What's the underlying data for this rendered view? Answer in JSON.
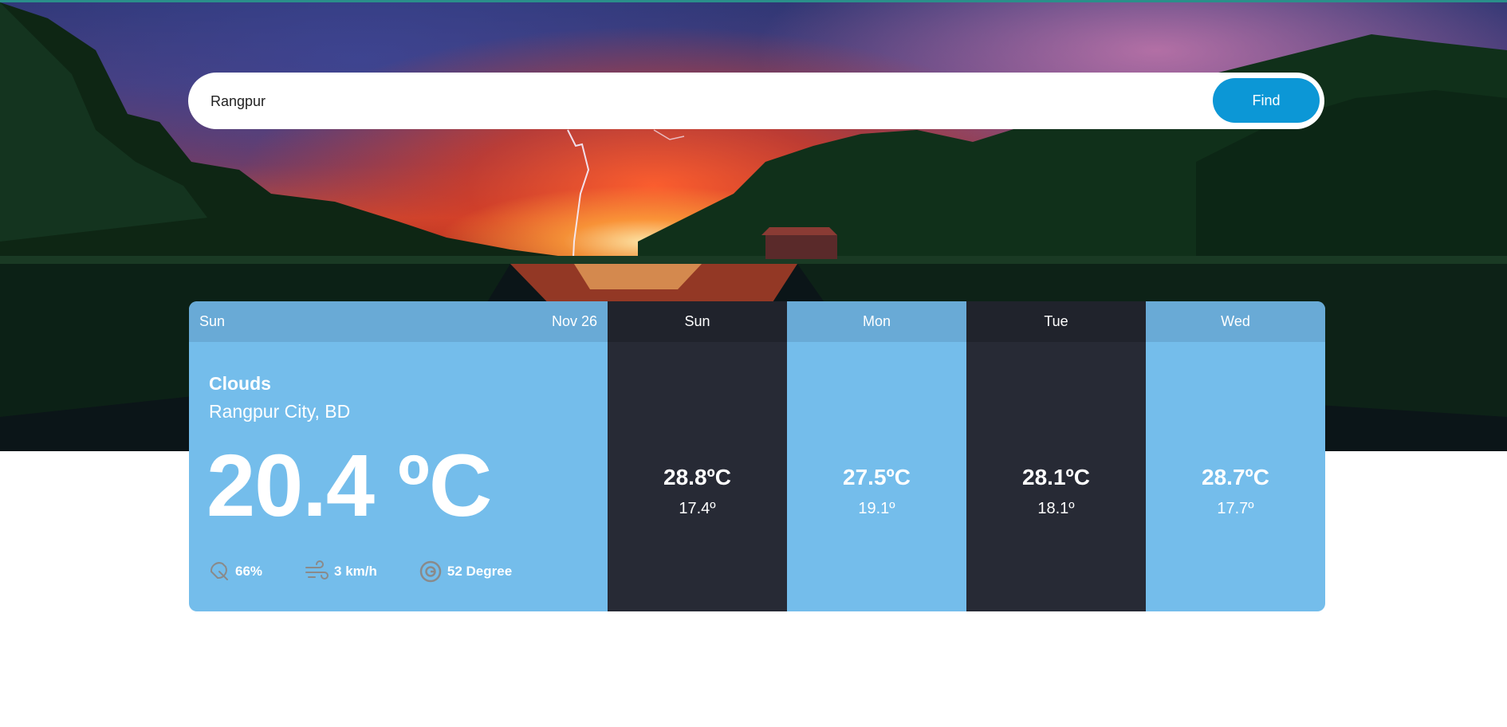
{
  "search": {
    "value": "Rangpur",
    "button_label": "Find"
  },
  "today": {
    "day": "Sun",
    "date": "Nov 26",
    "condition": "Clouds",
    "location": "Rangpur City, BD",
    "temperature": "20.4 ºC",
    "humidity": "66%",
    "wind": "3 km/h",
    "wind_direction": "52 Degree"
  },
  "forecast": [
    {
      "day": "Sun",
      "max": "28.8ºC",
      "min": "17.4º"
    },
    {
      "day": "Mon",
      "max": "27.5ºC",
      "min": "19.1º"
    },
    {
      "day": "Tue",
      "max": "28.1ºC",
      "min": "18.1º"
    },
    {
      "day": "Wed",
      "max": "28.7ºC",
      "min": "17.7º"
    }
  ],
  "colors": {
    "accent": "#0c97d6",
    "card_light": "#74bdeb",
    "card_dark": "#272a35",
    "icon_gray": "#8a8a8a"
  },
  "icons": [
    "umbrella-icon",
    "wind-icon",
    "compass-icon"
  ]
}
